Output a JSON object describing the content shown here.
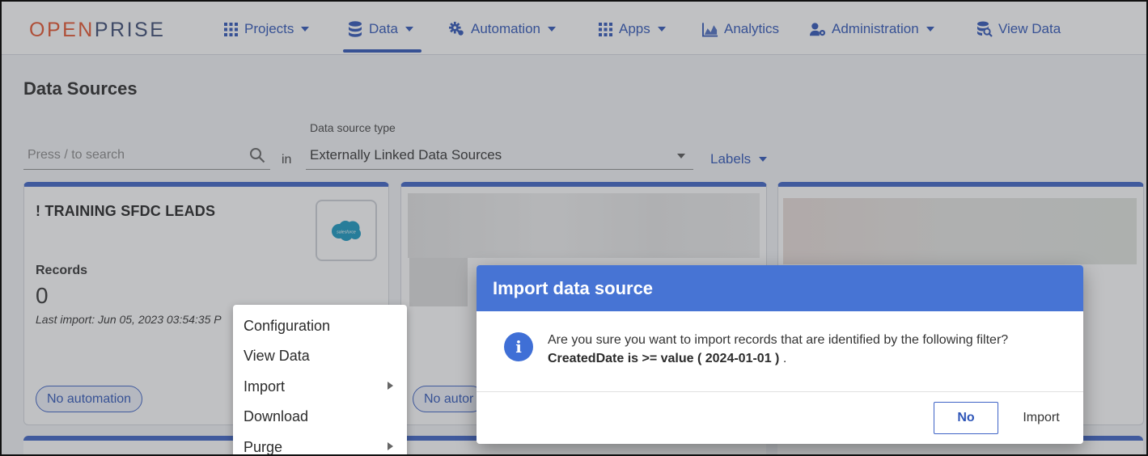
{
  "brand": {
    "part1": "OPEN",
    "part2": "PRISE"
  },
  "nav": {
    "projects": "Projects",
    "data": "Data",
    "automation": "Automation",
    "apps": "Apps",
    "analytics": "Analytics",
    "administration": "Administration",
    "view_data": "View Data"
  },
  "page": {
    "title": "Data Sources"
  },
  "filters": {
    "search_placeholder": "Press / to search",
    "in_label": "in",
    "type_label": "Data source type",
    "type_value": "Externally Linked Data Sources",
    "labels": "Labels"
  },
  "card1": {
    "title": "! TRAINING SFDC LEADS",
    "logo_text": "salesforce",
    "records_label": "Records",
    "records_count": "0",
    "last_import": "Last import: Jun 05, 2023 03:54:35 P",
    "automation": "No automation"
  },
  "card2": {
    "automation": "No autor"
  },
  "context_menu": {
    "configuration": "Configuration",
    "view_data": "View Data",
    "import": "Import",
    "download": "Download",
    "purge": "Purge"
  },
  "dialog": {
    "title": "Import data source",
    "message": "Are you sure you want to import records that are identified by the following filter?",
    "filter": "CreatedDate is >= value ( 2024-01-01 )",
    "filter_suffix": " .",
    "no": "No",
    "import": "Import"
  },
  "colors": {
    "primary": "#2f56b8",
    "card_accent": "#3e63c6",
    "dialog_header": "#4774d4",
    "logo_orange": "#e5532d"
  }
}
